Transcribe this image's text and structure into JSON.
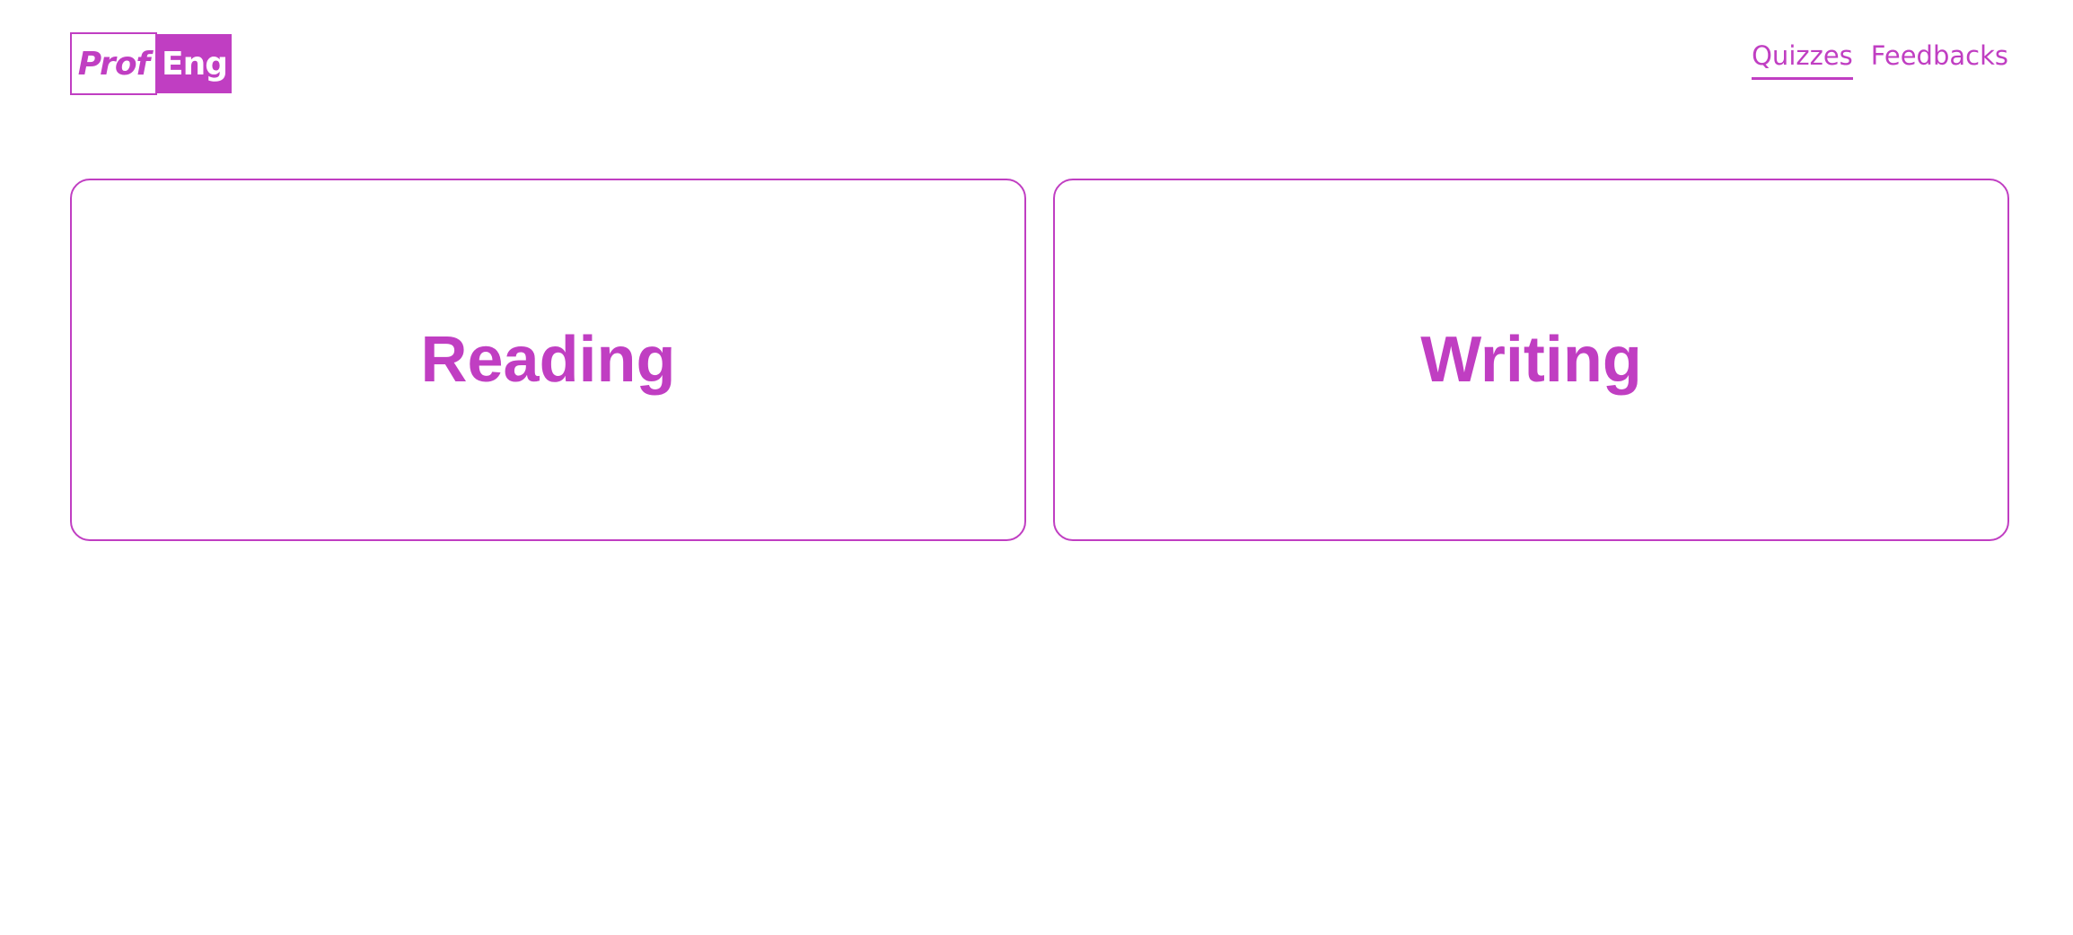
{
  "header": {
    "logo": {
      "part1": "Prof",
      "part2": "Eng"
    },
    "nav": [
      {
        "label": "Quizzes",
        "active": true
      },
      {
        "label": "Feedbacks",
        "active": false
      }
    ]
  },
  "main": {
    "cards": [
      {
        "label": "Reading"
      },
      {
        "label": "Writing"
      }
    ]
  },
  "colors": {
    "accent": "#c03ec2",
    "background": "#ffffff"
  }
}
